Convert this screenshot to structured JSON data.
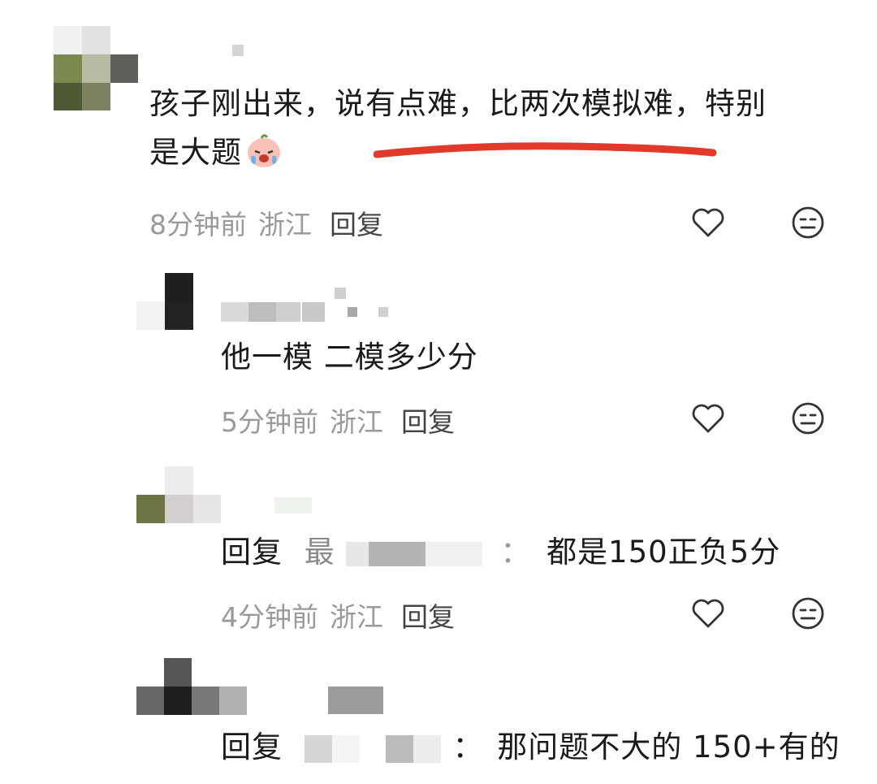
{
  "comments": [
    {
      "text_line1": "孩子刚出来，说有点难，比两次模拟难，特别",
      "text_line2": "是大题",
      "emoji": "crying-face",
      "time": "8分钟前",
      "location": "浙江",
      "reply_label": "回复"
    },
    {
      "text": "他一模 二模多少分",
      "time": "5分钟前",
      "location": "浙江",
      "reply_label": "回复"
    },
    {
      "reply_prefix": "回复",
      "partial_name": "最",
      "separator": "：",
      "text": "都是150正负5分",
      "time": "4分钟前",
      "location": "浙江",
      "reply_label": "回复"
    },
    {
      "reply_prefix": "回复",
      "separator": "：",
      "text": "那问题不大的 150+有的"
    }
  ],
  "colors": {
    "underline": "#e23a2a",
    "icon": "#333333",
    "meta": "#9a9a9a"
  },
  "icons": [
    "heart-icon",
    "dislike-face-icon"
  ]
}
